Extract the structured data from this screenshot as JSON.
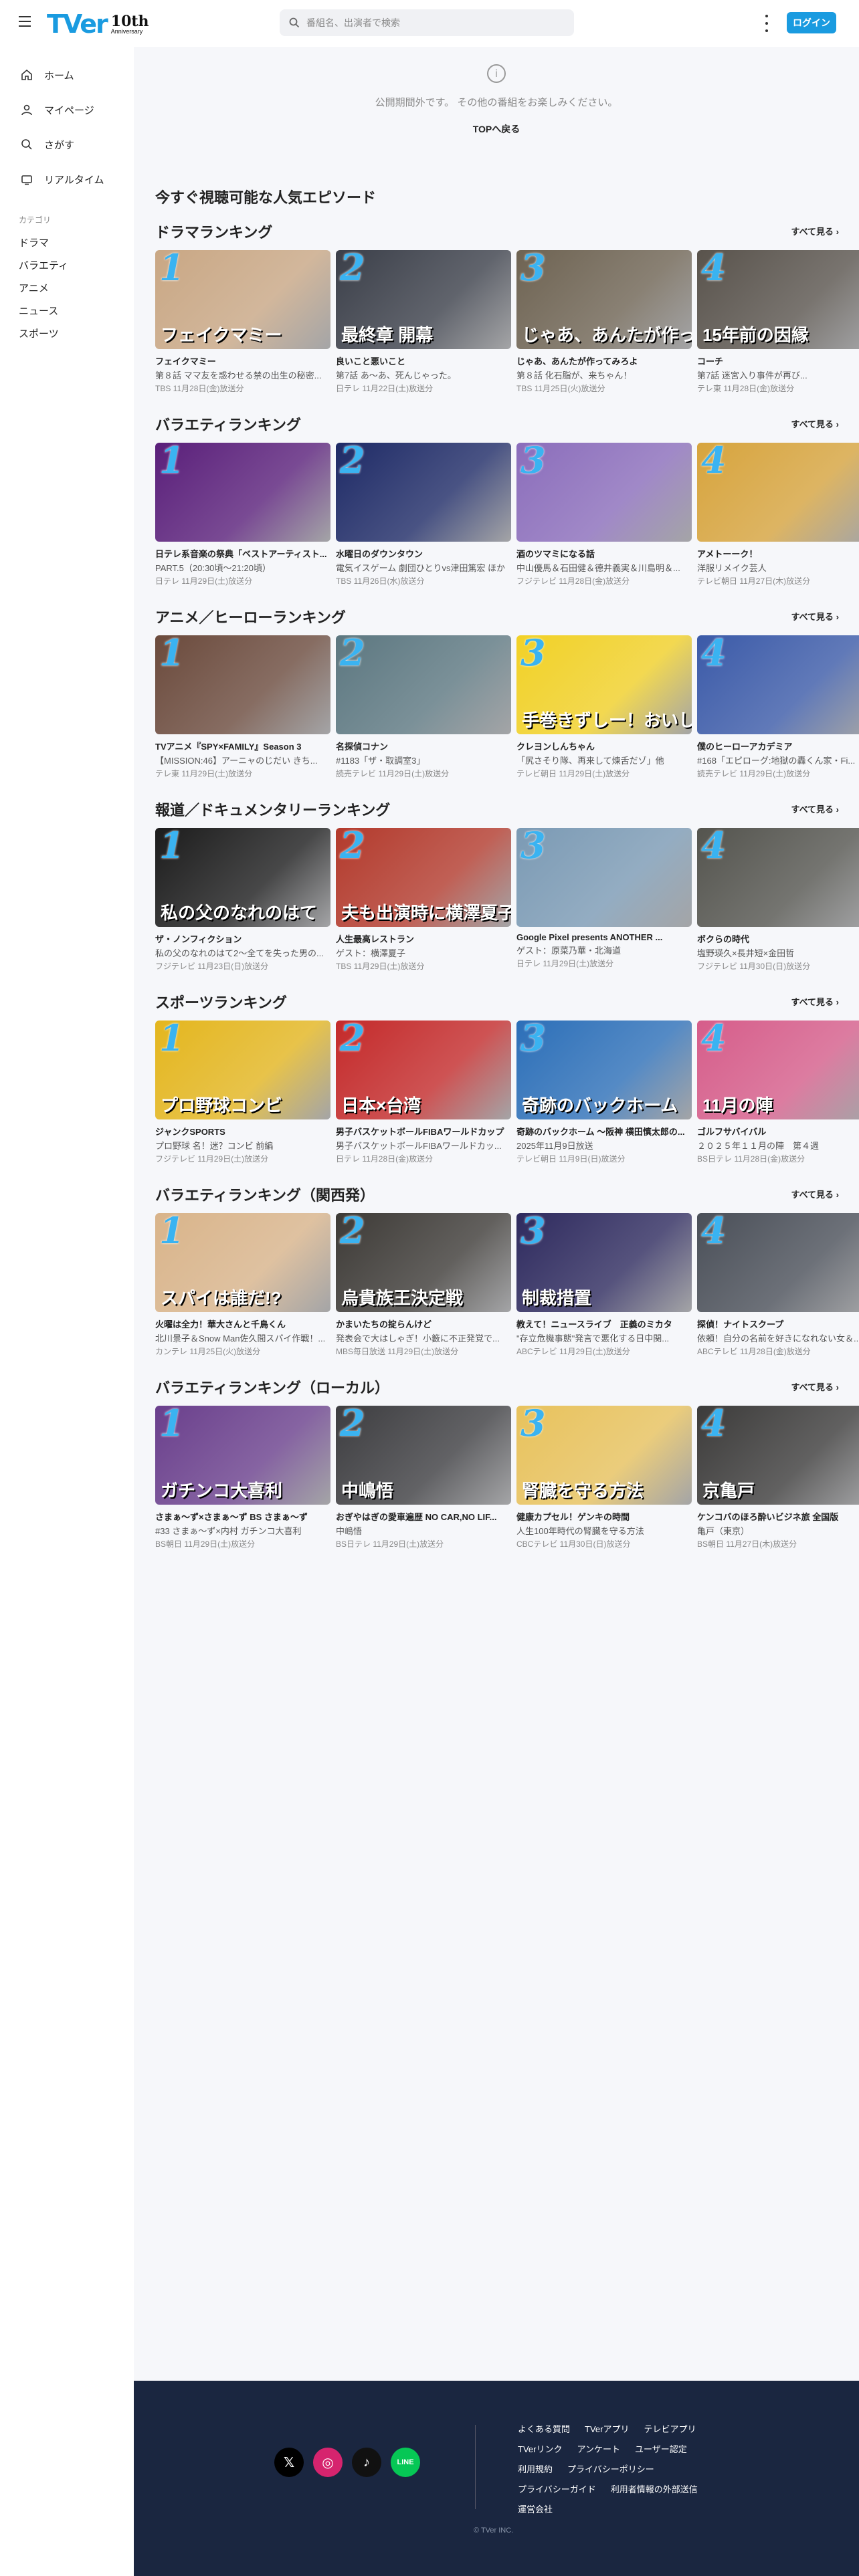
{
  "header": {
    "logo_text": "TVer",
    "logo_10": "10th",
    "logo_anniv": "Anniversary",
    "search_placeholder": "番組名、出演者で検索",
    "login_label": "ログイン"
  },
  "sidebar": {
    "nav": [
      {
        "label": "ホーム",
        "icon": "home-icon"
      },
      {
        "label": "マイページ",
        "icon": "user-icon"
      },
      {
        "label": "さがす",
        "icon": "search-icon"
      },
      {
        "label": "リアルタイム",
        "icon": "tv-icon"
      }
    ],
    "category_heading": "カテゴリ",
    "categories": [
      "ドラマ",
      "バラエティ",
      "アニメ",
      "ニュース",
      "スポーツ"
    ]
  },
  "notice": {
    "message": "公開期間外です。 その他の番組をお楽しみください。",
    "back_label": "TOPへ戻る"
  },
  "popular_title": "今すぐ視聴可能な人気エピソード",
  "see_all_label": "すべて見る ›",
  "sections": [
    {
      "title": "ドラマランキング",
      "cards": [
        {
          "rank": "1",
          "series": "フェイクマミー",
          "episode": "第８話 ママ友を惑わせる禁の出生の秘密...",
          "meta": "TBS 11月28日(金)放送分",
          "caption": "フェイクマミー",
          "bg": "#c9a784"
        },
        {
          "rank": "2",
          "series": "良いこと悪いこと",
          "episode": "第7話 あ〜あ、死んじゃった。",
          "meta": "日テレ 11月22日(土)放送分",
          "caption": "最終章 開幕",
          "bg": "#3b3f49"
        },
        {
          "rank": "3",
          "series": "じゃあ、あんたが作ってみろよ",
          "episode": "第８話 化石脂が、来ちゃん！",
          "meta": "TBS 11月25日(火)放送分",
          "caption": "じゃあ、あんたが作ってみろよ",
          "bg": "#6e6352"
        },
        {
          "rank": "4",
          "series": "コーチ",
          "episode": "第7話 迷宮入り事件が再び...",
          "meta": "テレ東 11月28日(金)放送分",
          "caption": "15年前の因縁",
          "bg": "#59534c"
        }
      ]
    },
    {
      "title": "バラエティランキング",
      "cards": [
        {
          "rank": "1",
          "series": "日テレ系音楽の祭典「ベストアーティスト...",
          "episode": "PART.5（20:30頃〜21:20頃）",
          "meta": "日テレ 11月29日(土)放送分",
          "caption": "",
          "bg": "#5a1f7a"
        },
        {
          "rank": "2",
          "series": "水曜日のダウンタウン",
          "episode": "電気イスゲーム 劇団ひとりvs津田篤宏 ほか",
          "meta": "TBS 11月26日(水)放送分",
          "caption": "",
          "bg": "#1e2a66"
        },
        {
          "rank": "3",
          "series": "酒のツマミになる話",
          "episode": "中山優馬＆石田健＆德井義実＆川島明＆...",
          "meta": "フジテレビ 11月28日(金)放送分",
          "caption": "",
          "bg": "#8b6dbb"
        },
        {
          "rank": "4",
          "series": "アメトーーク！",
          "episode": "洋服リメイク芸人",
          "meta": "テレビ朝日 11月27日(木)放送分",
          "caption": "",
          "bg": "#d7a43d"
        }
      ]
    },
    {
      "title": "アニメ／ヒーローランキング",
      "cards": [
        {
          "rank": "1",
          "series": "TVアニメ『SPY×FAMILY』Season 3",
          "episode": "【MISSION:46】アーニャのじだい きち...",
          "meta": "テレ東 11月29日(土)放送分",
          "caption": "",
          "bg": "#6b4a3c"
        },
        {
          "rank": "2",
          "series": "名探偵コナン",
          "episode": "#1183「ザ・取調室3」",
          "meta": "読売テレビ 11月29日(土)放送分",
          "caption": "",
          "bg": "#5c7780"
        },
        {
          "rank": "3",
          "series": "クレヨンしんちゃん",
          "episode": "「尻さそり隊、再来して煉舌だゾ」他",
          "meta": "テレビ朝日 11月29日(土)放送分",
          "caption": "手巻きずしー！おいしー！",
          "bg": "#f2d126"
        },
        {
          "rank": "4",
          "series": "僕のヒーローアカデミア",
          "episode": "#168「エピローグ:地獄の轟くん家・Fi...",
          "meta": "読売テレビ 11月29日(土)放送分",
          "caption": "",
          "bg": "#3b5aa8"
        }
      ]
    },
    {
      "title": "報道／ドキュメンタリーランキング",
      "cards": [
        {
          "rank": "1",
          "series": "ザ・ノンフィクション",
          "episode": "私の父のなれのはて2〜全てを失った男の...",
          "meta": "フジテレビ 11月23日(日)放送分",
          "caption": "私の父のなれのはて",
          "bg": "#1c1c1c"
        },
        {
          "rank": "2",
          "series": "人生最高レストラン",
          "episode": "ゲスト：横澤夏子",
          "meta": "TBS 11月29日(土)放送分",
          "caption": "夫も出演時に横澤夏子",
          "bg": "#b33a2c"
        },
        {
          "rank": "3",
          "series": "Google Pixel presents ANOTHER ...",
          "episode": "ゲスト：原菜乃華・北海道",
          "meta": "日テレ 11月29日(土)放送分",
          "caption": "",
          "bg": "#7b9ab4"
        },
        {
          "rank": "4",
          "series": "ボクらの時代",
          "episode": "塩野瑛久×長井短×金田哲",
          "meta": "フジテレビ 11月30日(日)放送分",
          "caption": "",
          "bg": "#54544e"
        }
      ]
    },
    {
      "title": "スポーツランキング",
      "cards": [
        {
          "rank": "1",
          "series": "ジャンクSPORTS",
          "episode": "プロ野球 名！迷？コンビ 前編",
          "meta": "フジテレビ 11月29日(土)放送分",
          "caption": "プロ野球コンビ",
          "bg": "#e4b61e"
        },
        {
          "rank": "2",
          "series": "男子バスケットボールFIBAワールドカップ",
          "episode": "男子バスケットボールFIBAワールドカッ...",
          "meta": "日テレ 11月28日(金)放送分",
          "caption": "日本×台湾",
          "bg": "#c42a2a"
        },
        {
          "rank": "3",
          "series": "奇跡のバックホーム 〜阪神 横田慎太郎の...",
          "episode": "2025年11月9日放送",
          "meta": "テレビ朝日 11月9日(日)放送分",
          "caption": "奇跡のバックホーム",
          "bg": "#2c6fb8"
        },
        {
          "rank": "4",
          "series": "ゴルフサバイバル",
          "episode": "２０２５年１１月の陣　第４週",
          "meta": "BS日テレ 11月28日(金)放送分",
          "caption": "11月の陣",
          "bg": "#d65d8a"
        }
      ]
    },
    {
      "title": "バラエティランキング（関西発）",
      "cards": [
        {
          "rank": "1",
          "series": "火曜は全力！華大さんと千鳥くん",
          "episode": "北川景子＆Snow Man佐久間スパイ作戦！...",
          "meta": "カンテレ 11月25日(火)放送分",
          "caption": "スパイは誰だ!?",
          "bg": "#d9b48a"
        },
        {
          "rank": "2",
          "series": "かまいたちの掟らんけど",
          "episode": "発表会で大はしゃぎ！小籔に不正発覚で...",
          "meta": "MBS毎日放送 11月29日(土)放送分",
          "caption": "烏貴族王決定戦",
          "bg": "#3d3a36"
        },
        {
          "rank": "3",
          "series": "教えて！ニュースライブ　正義のミカタ",
          "episode": "\"存立危機事態\"発言で悪化する日中関...",
          "meta": "ABCテレビ 11月29日(土)放送分",
          "caption": "制裁措置",
          "bg": "#2e2a5e"
        },
        {
          "rank": "4",
          "series": "探偵！ナイトスクープ",
          "episode": "依頼！自分の名前を好きになれない女＆...",
          "meta": "ABCテレビ 11月28日(金)放送分",
          "caption": "",
          "bg": "#4a4f58"
        }
      ]
    },
    {
      "title": "バラエティランキング（ローカル）",
      "cards": [
        {
          "rank": "1",
          "series": "さまぁ〜ず×さまぁ〜ず BS さまぁ〜ず",
          "episode": "#33 さまぁ〜ず×内村 ガチンコ大喜利",
          "meta": "BS朝日 11月29日(土)放送分",
          "caption": "ガチンコ大喜利",
          "bg": "#6a3f8c"
        },
        {
          "rank": "2",
          "series": "おぎやはぎの愛車遍歴 NO CAR,NO LIF...",
          "episode": "中嶋悟",
          "meta": "BS日テレ 11月29日(土)放送分",
          "caption": "中嶋悟",
          "bg": "#3d3d40"
        },
        {
          "rank": "3",
          "series": "健康カプセル！ゲンキの時間",
          "episode": "人生100年時代の腎臓を守る方法",
          "meta": "CBCテレビ 11月30日(日)放送分",
          "caption": "腎臓を守る方法",
          "bg": "#e8c25c"
        },
        {
          "rank": "4",
          "series": "ケンコバのほろ酔いビジネ旅 全国版",
          "episode": "亀戸（東京）",
          "meta": "BS朝日 11月27日(木)放送分",
          "caption": "京亀戸",
          "bg": "#3c3b3a"
        }
      ]
    }
  ],
  "footer": {
    "socials": [
      {
        "name": "x-icon",
        "glyph": "𝕏",
        "color": "#000000"
      },
      {
        "name": "instagram-icon",
        "glyph": "◎",
        "color": "#d6246e"
      },
      {
        "name": "tiktok-icon",
        "glyph": "♪",
        "color": "#111111"
      },
      {
        "name": "line-icon",
        "glyph": "LINE",
        "color": "#06c755"
      }
    ],
    "links": [
      [
        "よくある質問",
        "TVerアプリ",
        "テレビアプリ"
      ],
      [
        "TVerリンク",
        "アンケート",
        "ユーザー認定"
      ],
      [
        "利用規約",
        "プライバシーポリシー"
      ],
      [
        "プライバシーガイド",
        "利用者情報の外部送信"
      ],
      [
        "運営会社"
      ]
    ],
    "copyright": "© TVer INC."
  }
}
